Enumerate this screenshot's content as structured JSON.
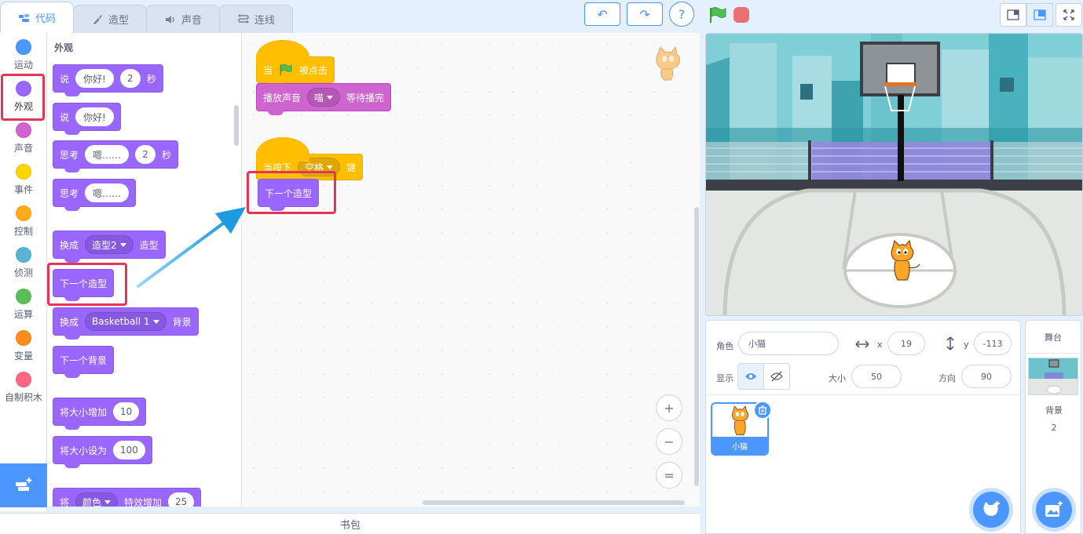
{
  "tabs": [
    {
      "label": "代码",
      "active": true
    },
    {
      "label": "造型",
      "active": false
    },
    {
      "label": "声音",
      "active": false
    },
    {
      "label": "连线",
      "active": false
    }
  ],
  "toolbar": {
    "undo": "↶",
    "redo": "↷",
    "help": "?"
  },
  "categories": [
    {
      "label": "运动",
      "color": "#4c97ff"
    },
    {
      "label": "外观",
      "color": "#9966ff",
      "selected": true
    },
    {
      "label": "声音",
      "color": "#cf63cf"
    },
    {
      "label": "事件",
      "color": "#ffd500"
    },
    {
      "label": "控制",
      "color": "#ffab19"
    },
    {
      "label": "侦测",
      "color": "#5cb1d6"
    },
    {
      "label": "运算",
      "color": "#59c059"
    },
    {
      "label": "变量",
      "color": "#ff8c1a"
    },
    {
      "label": "自制积木",
      "color": "#ff6680"
    }
  ],
  "palette": {
    "title": "外观",
    "blocks": {
      "say_for": {
        "word1": "说",
        "text": "你好!",
        "secs": "2",
        "word2": "秒"
      },
      "say": {
        "word1": "说",
        "text": "你好!"
      },
      "think_for": {
        "word1": "思考",
        "text": "嗯……",
        "secs": "2",
        "word2": "秒"
      },
      "think": {
        "word1": "思考",
        "text": "嗯……"
      },
      "switch_costume": {
        "word1": "换成",
        "value": "造型2",
        "word2": "造型"
      },
      "next_costume": {
        "label": "下一个造型"
      },
      "switch_backdrop": {
        "word1": "换成",
        "value": "Basketball 1",
        "word2": "背景"
      },
      "next_backdrop": {
        "label": "下一个背景"
      },
      "change_size": {
        "label": "将大小增加",
        "value": "10"
      },
      "set_size": {
        "label": "将大小设为",
        "value": "100"
      },
      "change_effect": {
        "word1": "将",
        "value": "颜色",
        "word2": "特效增加",
        "num": "25"
      }
    }
  },
  "workspace": {
    "script1": {
      "hat_word1": "当",
      "hat_word2": "被点击",
      "play_sound": "播放声音",
      "sound": "喵",
      "until_done": "等待播完"
    },
    "script2": {
      "hat_word1": "当按下",
      "key": "空格",
      "hat_word2": "键",
      "next_costume": "下一个造型"
    },
    "zoom": {
      "in": "+",
      "out": "−",
      "reset": "="
    }
  },
  "sprite_info": {
    "sprite_label": "角色",
    "sprite_name": "小猫",
    "x_label": "x",
    "x": "19",
    "y_label": "y",
    "y": "-113",
    "show_label": "显示",
    "size_label": "大小",
    "size": "50",
    "direction_label": "方向",
    "direction": "90"
  },
  "sprites": [
    {
      "name": "小猫",
      "selected": true
    }
  ],
  "stage_panel": {
    "title": "舞台",
    "backdrop_label": "背景",
    "backdrop_count": "2"
  },
  "backpack": {
    "label": "书包"
  }
}
